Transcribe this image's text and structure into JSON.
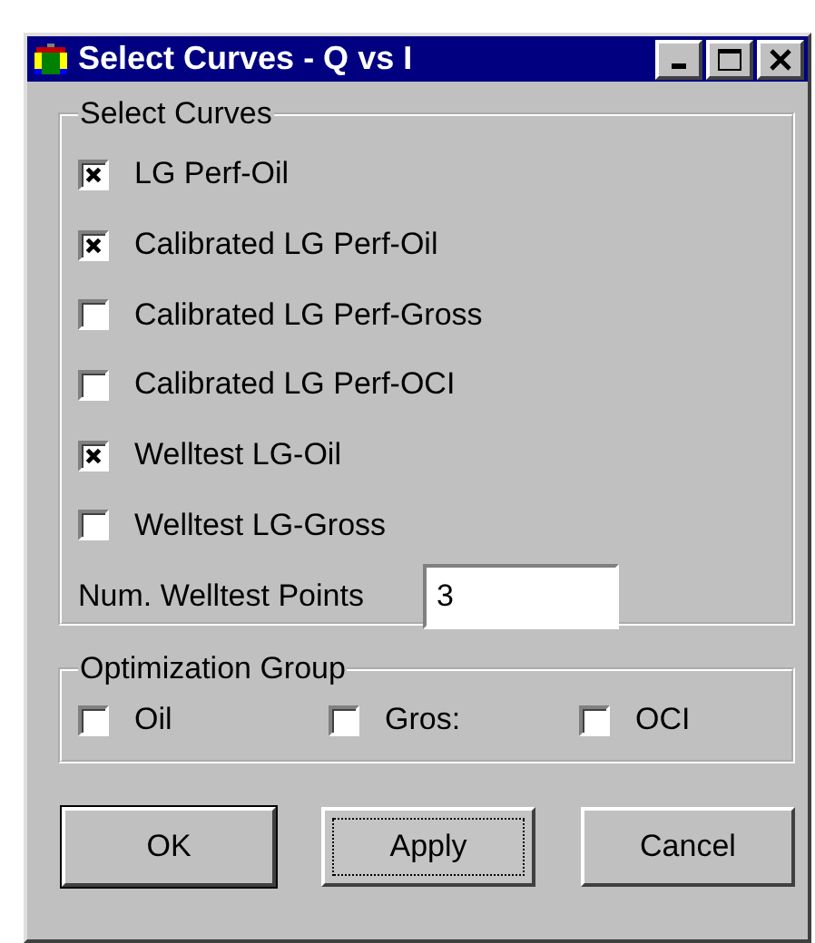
{
  "window": {
    "title": "Select Curves - Q vs I"
  },
  "select_curves": {
    "title": "Select Curves",
    "items": [
      {
        "label": "LG Perf-Oil",
        "checked": true
      },
      {
        "label": "Calibrated LG Perf-Oil",
        "checked": true
      },
      {
        "label": "Calibrated LG Perf-Gross",
        "checked": false
      },
      {
        "label": "Calibrated LG Perf-OCI",
        "checked": false
      },
      {
        "label": "Welltest LG-Oil",
        "checked": true
      },
      {
        "label": "Welltest LG-Gross",
        "checked": false
      }
    ],
    "num_points": {
      "label": "Num. Welltest Points",
      "value": "3"
    }
  },
  "optimization_group": {
    "title": "Optimization Group",
    "items": [
      {
        "label": "Oil",
        "checked": false
      },
      {
        "label": "Gros:",
        "checked": false
      },
      {
        "label": "OCI",
        "checked": false
      }
    ]
  },
  "buttons": [
    {
      "label": "OK",
      "default": true,
      "focused": false
    },
    {
      "label": "Apply",
      "default": false,
      "focused": true
    },
    {
      "label": "Cancel",
      "default": false,
      "focused": false
    }
  ]
}
